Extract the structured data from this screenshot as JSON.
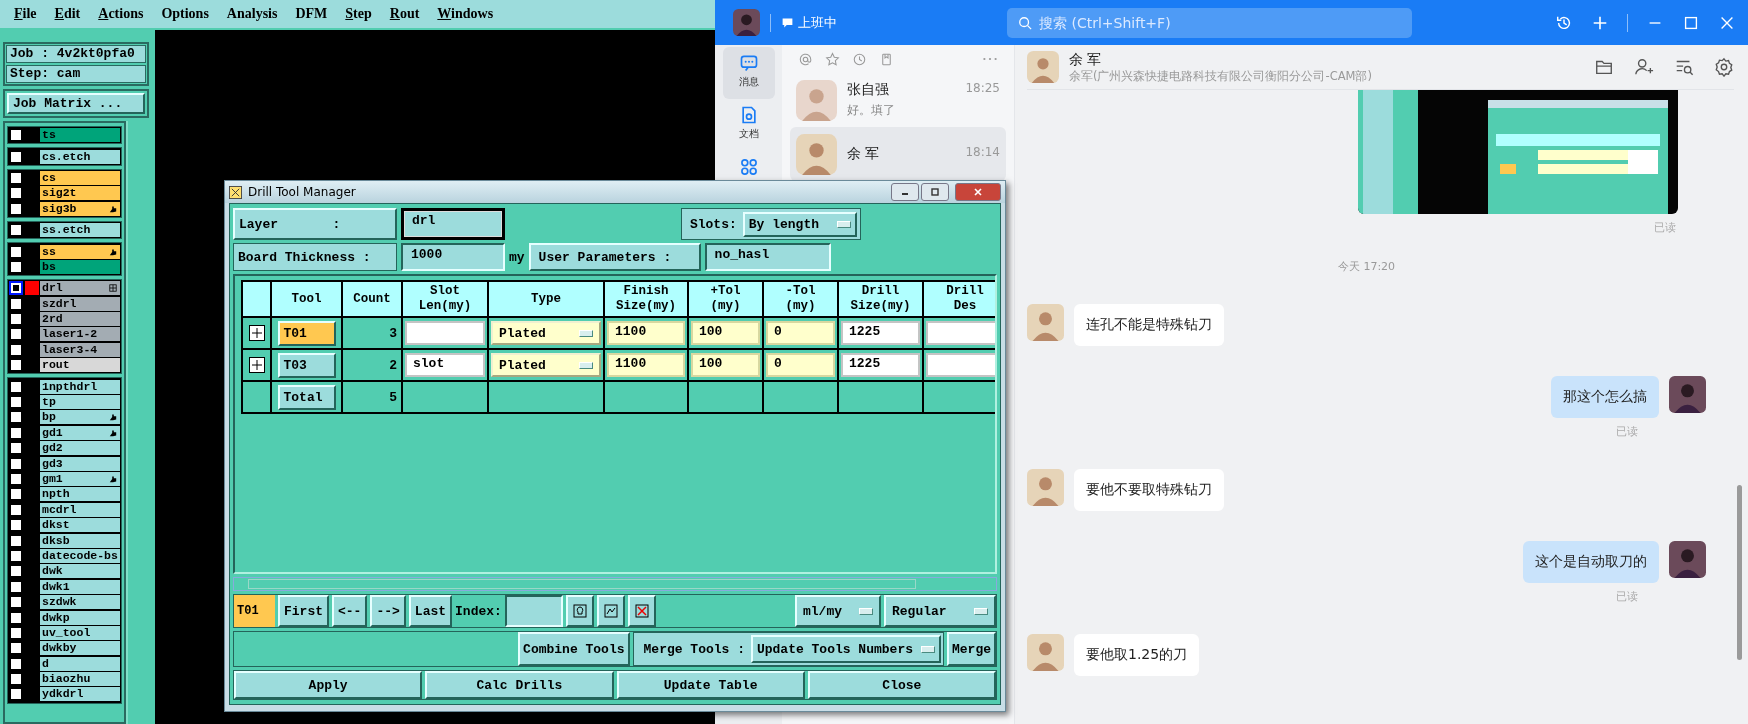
{
  "cam": {
    "menu": [
      {
        "label": "File",
        "mnemonic": true
      },
      {
        "label": "Edit",
        "mnemonic": true
      },
      {
        "label": "Actions",
        "mnemonic": true
      },
      {
        "label": "Options",
        "mnemonic": false
      },
      {
        "label": "Analysis",
        "mnemonic": false
      },
      {
        "label": "DFM",
        "mnemonic": false
      },
      {
        "label": "Step",
        "mnemonic": true
      },
      {
        "label": "Rout",
        "mnemonic": true
      },
      {
        "label": "Windows",
        "mnemonic": true
      }
    ],
    "job": "Job : 4v2kt0pfa0",
    "step": "Step: cam",
    "matrix_button": "Job Matrix ...",
    "layer_groups": [
      {
        "layers": [
          {
            "name": "ts",
            "color": "#00a47a",
            "selected": false,
            "kind": "plain"
          }
        ]
      },
      {
        "layers": [
          {
            "name": "cs.etch",
            "color": "#9cdcdc",
            "selected": false,
            "kind": "plain"
          }
        ]
      },
      {
        "layers": [
          {
            "name": "cs",
            "color": "#ffc850",
            "selected": false,
            "kind": "plain"
          },
          {
            "name": "sig2t",
            "color": "#ffc850",
            "selected": false,
            "kind": "plain"
          },
          {
            "name": "sig3b",
            "color": "#ffc850",
            "selected": false,
            "kind": "hand"
          }
        ]
      },
      {
        "layers": [
          {
            "name": "ss.etch",
            "color": "#9cdcdc",
            "selected": false,
            "kind": "plain"
          }
        ]
      },
      {
        "layers": [
          {
            "name": "ss",
            "color": "#ffc850",
            "selected": false,
            "kind": "hand"
          },
          {
            "name": "bs",
            "color": "#00a47a",
            "selected": false,
            "kind": "plain"
          }
        ]
      },
      {
        "layers": [
          {
            "name": "drl",
            "color": "#a3acb3",
            "selected": true,
            "kind": "grid"
          },
          {
            "name": "szdrl",
            "color": "#a3acb3",
            "selected": false
          },
          {
            "name": "2rd",
            "color": "#a3acb3",
            "selected": false
          },
          {
            "name": "laser1-2",
            "color": "#a3acb3",
            "selected": false
          },
          {
            "name": "laser3-4",
            "color": "#a3acb3",
            "selected": false
          },
          {
            "name": "rout",
            "color": "#d8d8d8",
            "selected": false
          }
        ]
      },
      {
        "layers": [
          {
            "name": "1npthdrl",
            "color": "#9cdcdc",
            "selected": false
          },
          {
            "name": "tp",
            "color": "#9cdcdc",
            "selected": false
          },
          {
            "name": "bp",
            "color": "#9cdcdc",
            "selected": false,
            "kind": "hand"
          },
          {
            "name": "gd1",
            "color": "#9cdcdc",
            "selected": false,
            "kind": "hand"
          },
          {
            "name": "gd2",
            "color": "#9cdcdc",
            "selected": false
          },
          {
            "name": "gd3",
            "color": "#9cdcdc",
            "selected": false
          },
          {
            "name": "gm1",
            "color": "#9cdcdc",
            "selected": false,
            "kind": "hand"
          },
          {
            "name": "npth",
            "color": "#9cdcdc",
            "selected": false
          },
          {
            "name": "mcdrl",
            "color": "#9cdcdc",
            "selected": false
          },
          {
            "name": "dkst",
            "color": "#9cdcdc",
            "selected": false
          },
          {
            "name": "dksb",
            "color": "#9cdcdc",
            "selected": false
          },
          {
            "name": "datecode-bs",
            "color": "#9cdcdc",
            "selected": false
          },
          {
            "name": "dwk",
            "color": "#9cdcdc",
            "selected": false
          },
          {
            "name": "dwk1",
            "color": "#9cdcdc",
            "selected": false
          },
          {
            "name": "szdwk",
            "color": "#9cdcdc",
            "selected": false
          },
          {
            "name": "dwkp",
            "color": "#9cdcdc",
            "selected": false
          },
          {
            "name": "uv_tool",
            "color": "#9cdcdc",
            "selected": false
          },
          {
            "name": "dwkby",
            "color": "#9cdcdc",
            "selected": false
          },
          {
            "name": "d",
            "color": "#9cdcdc",
            "selected": false
          },
          {
            "name": "biaozhu",
            "color": "#9cdcdc",
            "selected": false
          },
          {
            "name": "ydkdrl",
            "color": "#9cdcdc",
            "selected": false
          }
        ]
      }
    ]
  },
  "dialog": {
    "title": "Drill Tool Manager",
    "layer_label": "Layer       :",
    "layer_value": "drl",
    "slots_label": "Slots:",
    "slots_value": "By length",
    "thickness_label": "Board Thickness :",
    "thickness_value": "1000",
    "thickness_unit": "my",
    "user_params_button": "User Parameters :",
    "user_params_value": "no_hasl",
    "columns": [
      "Tool",
      "Count",
      "Slot\nLen(my)",
      "Type",
      "Finish\nSize(my)",
      "+Tol\n(my)",
      "-Tol\n(my)",
      "Drill\nSize(my)",
      "Drill\nDes"
    ],
    "rows": [
      {
        "tool": "T01",
        "selected": true,
        "count": "3",
        "type": "Plated",
        "finish": "1100",
        "plus_tol": "100",
        "minus_tol": "0",
        "drill_size": "1225"
      },
      {
        "tool": "T03",
        "selected": false,
        "count": "2",
        "slot_len": "slot",
        "type": "Plated",
        "finish": "1100",
        "plus_tol": "100",
        "minus_tol": "0",
        "drill_size": "1225"
      }
    ],
    "total": {
      "label": "Total",
      "count": "5"
    },
    "current_tool": "T01",
    "nav_buttons": [
      "First",
      "<--",
      "-->",
      "Last"
    ],
    "index_label": "Index:",
    "units": "ml/my",
    "mode": "Regular",
    "combine_button": "Combine Tools",
    "merge_label": "Merge Tools :",
    "merge_option": "Update Tools Numbers",
    "merge_button": "Merge",
    "actions": [
      "Apply",
      "Calc Drills",
      "Update Table",
      "Close"
    ]
  },
  "chat": {
    "status": "上班中",
    "search_placeholder": "搜索 (Ctrl+Shift+F)",
    "nav": [
      {
        "kind": "message",
        "label": "消息",
        "selected": true
      },
      {
        "kind": "docs",
        "label": "文档",
        "selected": false
      },
      {
        "kind": "apps",
        "selected": false
      }
    ],
    "conversations": [
      {
        "name": "张自强",
        "time": "18:25",
        "preview": "好。填了",
        "selected": false
      },
      {
        "name": "余 军",
        "time": "18:14",
        "selected": true
      }
    ],
    "contact": {
      "name": "余 军",
      "subtitle": "余军(广州兴森快捷电路科技有限公司衡阳分公司-CAM部)"
    },
    "messages": [
      {
        "receipt": "已读"
      },
      {
        "kind": "time",
        "text": "今天 17:20"
      },
      {
        "kind": "incoming",
        "text": "连孔不能是特殊钻刀"
      },
      {
        "kind": "outgoing",
        "text": "那这个怎么搞",
        "receipt": "已读"
      },
      {
        "kind": "incoming",
        "text": "要他不要取特殊钻刀"
      },
      {
        "kind": "outgoing",
        "text": "这个是自动取刀的",
        "receipt": "已读"
      },
      {
        "kind": "incoming",
        "text": "要他取1.25的刀"
      }
    ]
  }
}
